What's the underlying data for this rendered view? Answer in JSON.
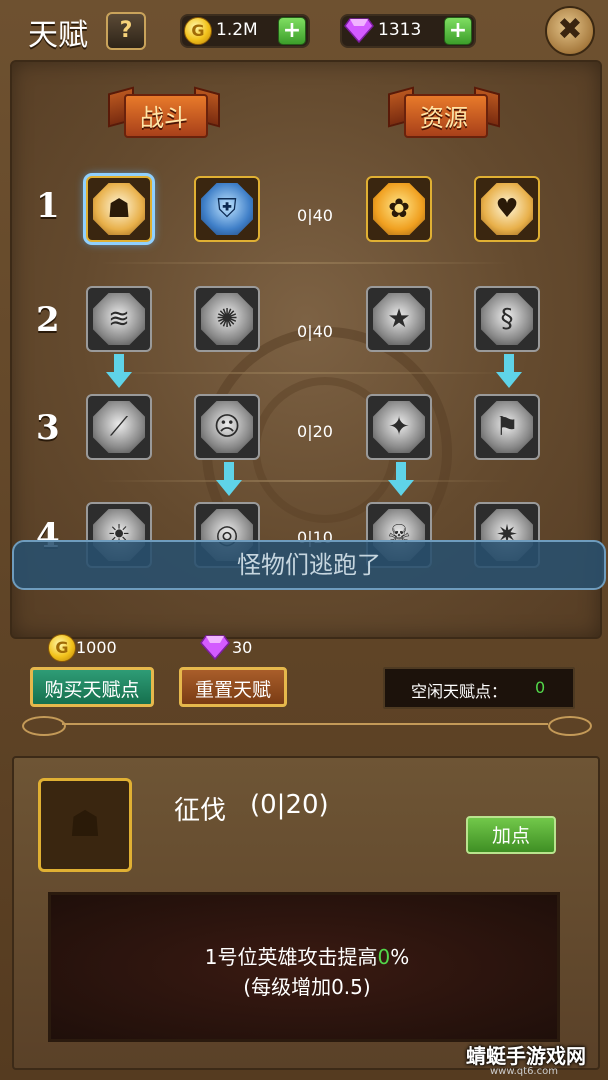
{
  "header": {
    "title": "天赋",
    "help_label": "?",
    "gold_amount": "1.2M",
    "gem_amount": "1313",
    "plus_label": "+",
    "close_label": "✖"
  },
  "tabs": {
    "combat": "战斗",
    "resource": "资源"
  },
  "rows": [
    {
      "num": "1",
      "count": "0|40"
    },
    {
      "num": "2",
      "count": "0|40"
    },
    {
      "num": "3",
      "count": "0|20"
    },
    {
      "num": "4",
      "count": "0|10"
    }
  ],
  "toast": "怪物们逃跑了",
  "actions": {
    "buy_cost": "1000",
    "buy_label": "购买天赋点",
    "reset_cost": "30",
    "reset_label": "重置天赋",
    "idle_label": "空闲天赋点：",
    "idle_value": "0"
  },
  "detail": {
    "name": "征伐",
    "level": "(0|20)",
    "add_label": "加点",
    "desc_prefix": "1号位英雄攻击提高",
    "desc_value": "0",
    "desc_suffix": "%",
    "desc_line2": "(每级增加0.5)"
  },
  "watermark": {
    "main": "蜻蜓手游戏网",
    "sub": "www.qt6.com"
  },
  "colors": {
    "accent_gold": "#e0b033",
    "arrow": "#5fd3e8",
    "green": "#52d64a",
    "selected": "#8fd0ff"
  }
}
